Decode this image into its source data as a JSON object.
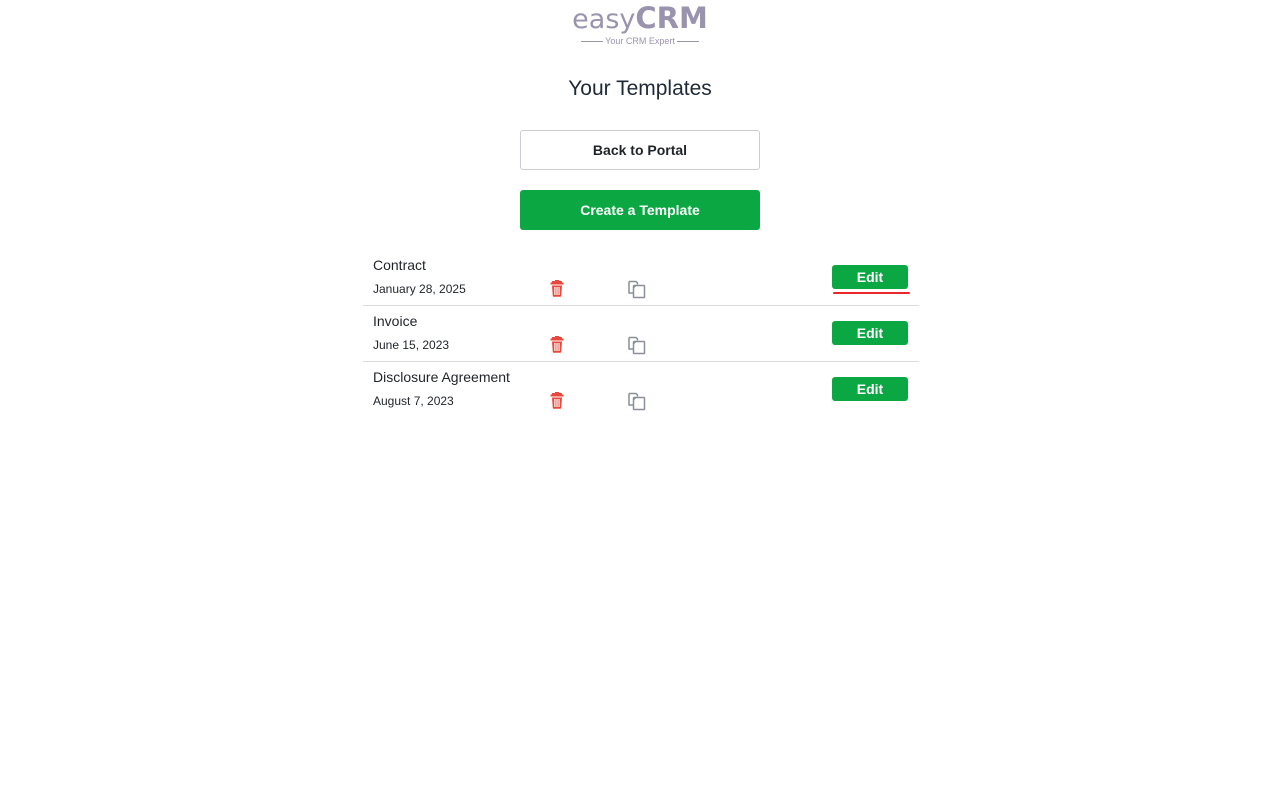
{
  "logo": {
    "easy": "easy",
    "crm": "CRM",
    "tagline": "Your CRM Expert"
  },
  "page": {
    "title": "Your Templates"
  },
  "actions": {
    "back_label": "Back to Portal",
    "create_label": "Create a Template"
  },
  "templates": [
    {
      "name": "Contract",
      "date": "January 28, 2025",
      "edit_label": "Edit"
    },
    {
      "name": "Invoice",
      "date": "June 15, 2023",
      "edit_label": "Edit"
    },
    {
      "name": "Disclosure Agreement",
      "date": "August 7, 2023",
      "edit_label": "Edit"
    }
  ],
  "icons": {
    "delete": "trash-icon",
    "duplicate": "copy-icon"
  },
  "colors": {
    "brand": "#9a93ae",
    "primary": "#0aa742",
    "danger": "#e8473c",
    "icon_muted": "#8a8f98",
    "highlight": "#e8262b"
  }
}
